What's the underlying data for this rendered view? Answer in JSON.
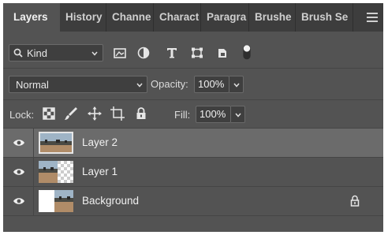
{
  "tabs": [
    "Layers",
    "History",
    "Channe",
    "Charact",
    "Paragra",
    "Brushe",
    "Brush Se"
  ],
  "filter": {
    "kind_label": "Kind",
    "icons": [
      "image-filter-icon",
      "adjustment-filter-icon",
      "type-filter-icon",
      "shape-filter-icon",
      "smart-object-filter-icon",
      "filter-toggle-icon"
    ]
  },
  "blend": {
    "mode": "Normal",
    "opacity_label": "Opacity:",
    "opacity_value": "100%"
  },
  "lock": {
    "label": "Lock:",
    "icons": [
      "lock-transparent-pixels-icon",
      "lock-image-pixels-icon",
      "lock-position-icon",
      "lock-artboard-icon",
      "lock-all-icon"
    ],
    "fill_label": "Fill:",
    "fill_value": "100%"
  },
  "layers": [
    {
      "name": "Layer 2",
      "selected": true,
      "visible": true,
      "locked": false
    },
    {
      "name": "Layer 1",
      "selected": false,
      "visible": true,
      "locked": false
    },
    {
      "name": "Background",
      "selected": false,
      "visible": true,
      "locked": true
    }
  ],
  "colors": {
    "panel": "#535353",
    "tab_bar": "#3d3d3d",
    "selected_row": "#6b6b6b",
    "text": "#e8e8e8"
  }
}
